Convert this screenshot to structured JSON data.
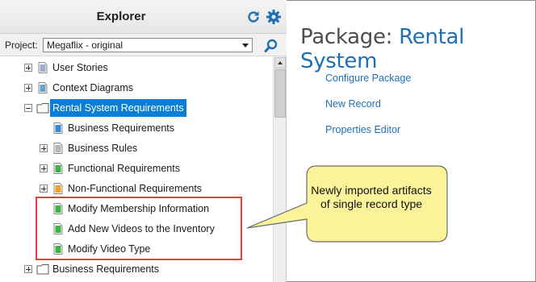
{
  "explorer": {
    "title": "Explorer",
    "project_label": "Project:",
    "project_value": "Megaflix - original"
  },
  "tree": {
    "items": [
      {
        "label": "User Stories",
        "icon": "user-stories-icon",
        "expander": "plus"
      },
      {
        "label": "Context Diagrams",
        "icon": "context-diagram-icon",
        "expander": "plus"
      },
      {
        "label": "Rental System Requirements",
        "icon": "folder-icon",
        "expander": "minus",
        "selected": true
      },
      {
        "label": "Business Requirements",
        "icon": "doc-blue-icon",
        "expander": "none"
      },
      {
        "label": "Business Rules",
        "icon": "doc-gray-icon",
        "expander": "plus"
      },
      {
        "label": "Functional Requirements",
        "icon": "doc-green-icon",
        "expander": "plus"
      },
      {
        "label": "Non-Functional Requirements",
        "icon": "doc-orange-icon",
        "expander": "plus"
      },
      {
        "label": "Modify Membership Information",
        "icon": "doc-green-icon",
        "expander": "none"
      },
      {
        "label": "Add New Videos to the Inventory",
        "icon": "doc-green-icon",
        "expander": "none"
      },
      {
        "label": "Modify Video Type",
        "icon": "doc-green-icon",
        "expander": "none"
      },
      {
        "label": "Business Requirements",
        "icon": "folder-icon",
        "expander": "plus"
      }
    ]
  },
  "package": {
    "title_prefix": "Package: ",
    "title_name": "Rental System",
    "links": [
      "Configure Package",
      "New Record",
      "Properties Editor"
    ]
  },
  "callout": {
    "text": "Newly imported artifacts of single record type"
  },
  "colors": {
    "accent": "#1f6fb4",
    "selection": "#0a7ed4",
    "highlight_border": "#e2403a",
    "callout_fill": "#fbf39a"
  }
}
